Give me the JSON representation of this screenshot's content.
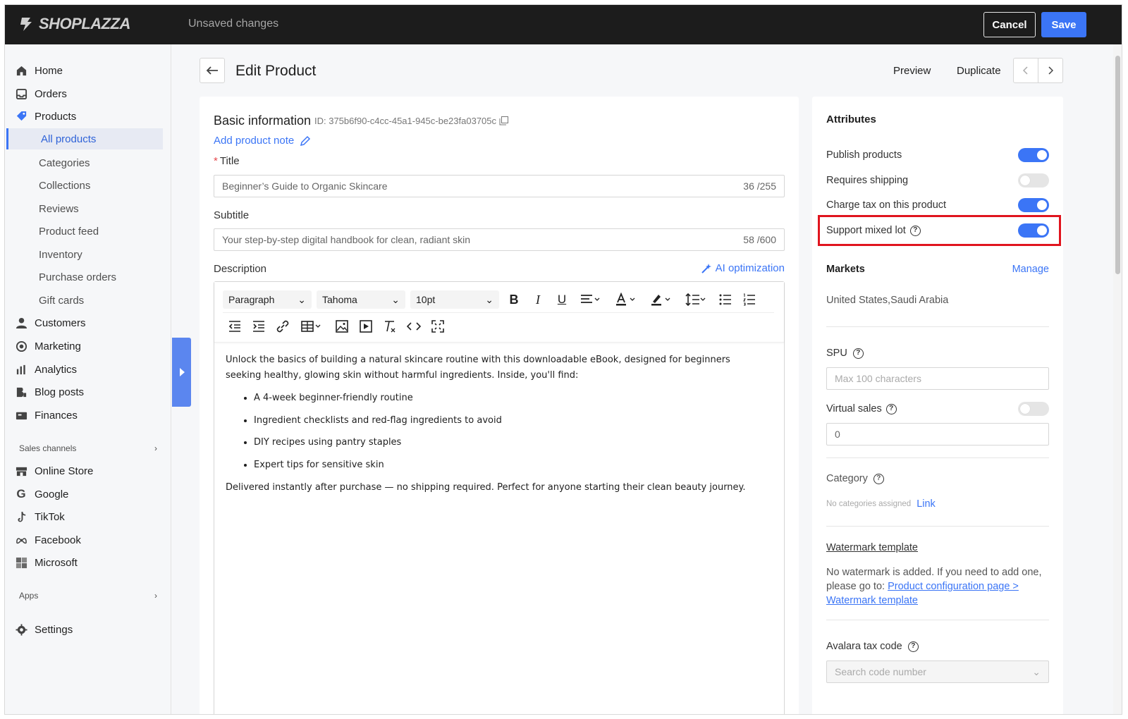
{
  "header": {
    "brand": "SHOPLAZZA",
    "status": "Unsaved changes",
    "cancel_label": "Cancel",
    "save_label": "Save"
  },
  "sidebar": {
    "items": [
      {
        "label": "Home",
        "icon": "home-icon"
      },
      {
        "label": "Orders",
        "icon": "inbox-icon"
      },
      {
        "label": "Products",
        "icon": "tag-icon"
      }
    ],
    "product_sub": [
      "All products",
      "Categories",
      "Collections",
      "Reviews",
      "Product feed",
      "Inventory",
      "Purchase orders",
      "Gift cards"
    ],
    "items2": [
      {
        "label": "Customers",
        "icon": "user-icon"
      },
      {
        "label": "Marketing",
        "icon": "target-icon"
      },
      {
        "label": "Analytics",
        "icon": "bar-chart-icon"
      },
      {
        "label": "Blog posts",
        "icon": "blog-icon"
      },
      {
        "label": "Finances",
        "icon": "finance-icon"
      }
    ],
    "sales_channels_label": "Sales channels",
    "channels": [
      {
        "label": "Online Store",
        "icon": "store-icon"
      },
      {
        "label": "Google",
        "icon": "google-icon"
      },
      {
        "label": "TikTok",
        "icon": "tiktok-icon"
      },
      {
        "label": "Facebook",
        "icon": "meta-icon"
      },
      {
        "label": "Microsoft",
        "icon": "microsoft-icon"
      }
    ],
    "apps_label": "Apps",
    "settings_label": "Settings"
  },
  "page": {
    "title": "Edit Product",
    "preview_label": "Preview",
    "duplicate_label": "Duplicate"
  },
  "basic": {
    "section_title": "Basic information",
    "id_text": "ID: 375b6f90-c4cc-45a1-945c-be23fa03705c",
    "add_note_label": "Add product note",
    "title_label": "Title",
    "title_value": "Beginner’s Guide to Organic Skincare",
    "title_count": "36 /255",
    "subtitle_label": "Subtitle",
    "subtitle_value": "Your step-by-step digital handbook for clean, radiant skin",
    "subtitle_count": "58 /600",
    "description_label": "Description",
    "ai_label": "AI optimization"
  },
  "editor": {
    "block_format": "Paragraph",
    "font_family": "Tahoma",
    "font_size": "10pt",
    "intro": "Unlock the basics of building a natural skincare routine with this downloadable eBook, designed for beginners seeking healthy, glowing skin without harmful ingredients. Inside, you'll find:",
    "bullets": [
      "A 4-week beginner-friendly routine",
      "Ingredient checklists and red-flag ingredients to avoid",
      "DIY recipes using pantry staples",
      "Expert tips for sensitive skin"
    ],
    "outro": "Delivered instantly after purchase — no shipping required. Perfect for anyone starting their clean beauty journey."
  },
  "attributes": {
    "title": "Attributes",
    "toggles": [
      {
        "label": "Publish products",
        "on": true
      },
      {
        "label": "Requires shipping",
        "on": false
      },
      {
        "label": "Charge tax on this product",
        "on": true
      },
      {
        "label": "Support mixed lot",
        "on": true
      }
    ],
    "markets_label": "Markets",
    "manage_label": "Manage",
    "markets_value": "United States,Saudi Arabia",
    "spu_label": "SPU",
    "spu_placeholder": "Max 100 characters",
    "virtual_sales_label": "Virtual sales",
    "virtual_sales_value": "0",
    "category_label": "Category",
    "no_categories": "No categories assigned",
    "link_label": "Link",
    "watermark_label": "Watermark template",
    "watermark_text": "No watermark is added. If you need to add one, please go to:",
    "watermark_link": "Product configuration page > Watermark template",
    "avalara_label": "Avalara tax code",
    "avalara_placeholder": "Search code number"
  },
  "colors": {
    "accent": "#3b75f6",
    "highlight": "#e0141e",
    "topbar": "#1c1c1c"
  }
}
